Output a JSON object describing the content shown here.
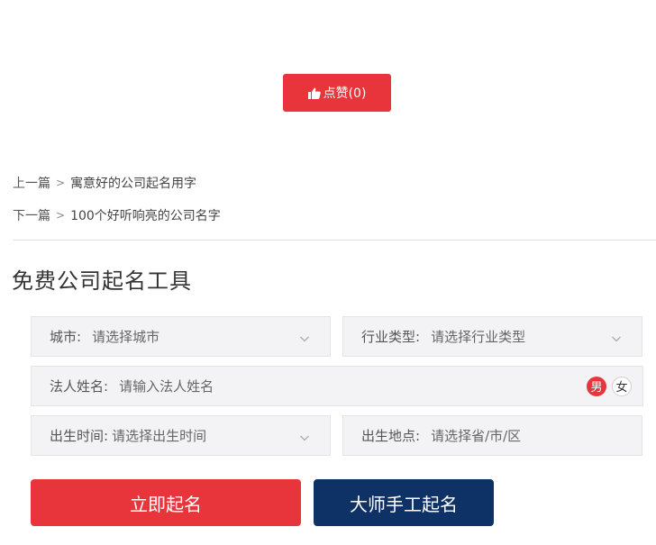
{
  "like_button": {
    "label": "点赞(0)",
    "icon": "thumbs-up-icon"
  },
  "nav": {
    "prev_prefix": "上一篇",
    "prev_sep": ">",
    "prev_title": "寓意好的公司起名用字",
    "next_prefix": "下一篇",
    "next_sep": ">",
    "next_title": "100个好听响亮的公司名字"
  },
  "tool": {
    "title": "免费公司起名工具",
    "city": {
      "label": "城市:",
      "placeholder": "请选择城市"
    },
    "industry": {
      "label": "行业类型:",
      "placeholder": "请选择行业类型"
    },
    "legal_name": {
      "label": "法人姓名:",
      "placeholder": "请输入法人姓名"
    },
    "gender": {
      "male": "男",
      "female": "女",
      "selected": "男"
    },
    "birth_time": {
      "label": "出生时间:",
      "placeholder": "请选择出生时间"
    },
    "birth_place": {
      "label": "出生地点:",
      "placeholder": "请选择省/市/区"
    },
    "submit_label": "立即起名",
    "master_label": "大师手工起名"
  },
  "colors": {
    "accent_red": "#e8353b",
    "navy": "#0e3166"
  }
}
